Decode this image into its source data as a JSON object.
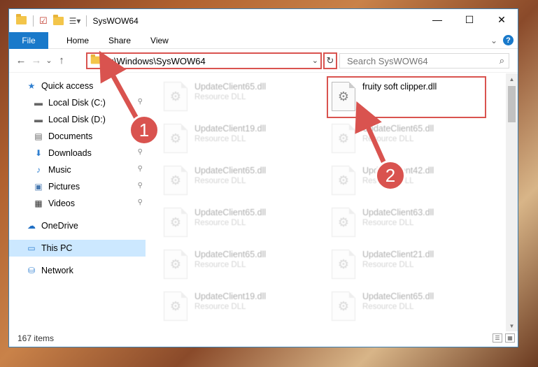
{
  "window": {
    "title": "SysWOW64",
    "controls": {
      "minimize": "—",
      "maximize": "☐",
      "close": "✕"
    }
  },
  "ribbon": {
    "file": "File",
    "tabs": [
      "Home",
      "Share",
      "View"
    ],
    "chevron": "⌄",
    "help": "?"
  },
  "nav": {
    "back": "←",
    "forward": "→",
    "recent": "⌄",
    "up": "↑",
    "address": "C:\\Windows\\SysWOW64",
    "address_drop": "⌄",
    "refresh": "↻",
    "search_placeholder": "Search SysWOW64",
    "search_icon": "⌕"
  },
  "sidebar": {
    "items": [
      {
        "label": "Quick access",
        "icon": "★",
        "icon_color": "#2f7fd0",
        "pinned": false
      },
      {
        "label": "Local Disk (C:)",
        "icon": "▬",
        "icon_color": "#666666",
        "pinned": true
      },
      {
        "label": "Local Disk (D:)",
        "icon": "▬",
        "icon_color": "#666666",
        "pinned": false
      },
      {
        "label": "Documents",
        "icon": "▤",
        "icon_color": "#666666",
        "pinned": false
      },
      {
        "label": "Downloads",
        "icon": "⬇",
        "icon_color": "#2f7fd0",
        "pinned": true
      },
      {
        "label": "Music",
        "icon": "♪",
        "icon_color": "#2f7fd0",
        "pinned": true
      },
      {
        "label": "Pictures",
        "icon": "▣",
        "icon_color": "#4a7ab0",
        "pinned": true
      },
      {
        "label": "Videos",
        "icon": "▦",
        "icon_color": "#333333",
        "pinned": true
      },
      {
        "label": "OneDrive",
        "icon": "☁",
        "icon_color": "#1f6fc4",
        "pinned": false
      },
      {
        "label": "This PC",
        "icon": "▭",
        "icon_color": "#2f7fd0",
        "pinned": false,
        "selected": true
      },
      {
        "label": "Network",
        "icon": "⛁",
        "icon_color": "#2f7fd0",
        "pinned": false
      }
    ],
    "pin_glyph": "📌"
  },
  "files": {
    "highlighted": {
      "name": "fruity soft clipper.dll",
      "type": ""
    },
    "ghost_left": [
      {
        "name": "UpdateClient65.dll",
        "type": "Resource DLL"
      },
      {
        "name": "UpdateClient19.dll",
        "type": "Resource DLL"
      },
      {
        "name": "UpdateClient65.dll",
        "type": "Resource DLL"
      },
      {
        "name": "UpdateClient65.dll",
        "type": "Resource DLL"
      },
      {
        "name": "UpdateClient65.dll",
        "type": "Resource DLL"
      },
      {
        "name": "UpdateClient19.dll",
        "type": "Resource DLL"
      }
    ],
    "ghost_right": [
      {
        "name": "UpdateClient65.dll",
        "type": "Resource DLL"
      },
      {
        "name": "UpdateClient42.dll",
        "type": "Resource DLL"
      },
      {
        "name": "UpdateClient63.dll",
        "type": "Resource DLL"
      },
      {
        "name": "UpdateClient21.dll",
        "type": "Resource DLL"
      },
      {
        "name": "UpdateClient65.dll",
        "type": "Resource DLL"
      }
    ]
  },
  "status": {
    "count": "167 items"
  },
  "badges": {
    "one": "1",
    "two": "2"
  },
  "colors": {
    "accent": "#1979ca",
    "annotation": "#d9534f",
    "selected": "#cce8ff"
  }
}
